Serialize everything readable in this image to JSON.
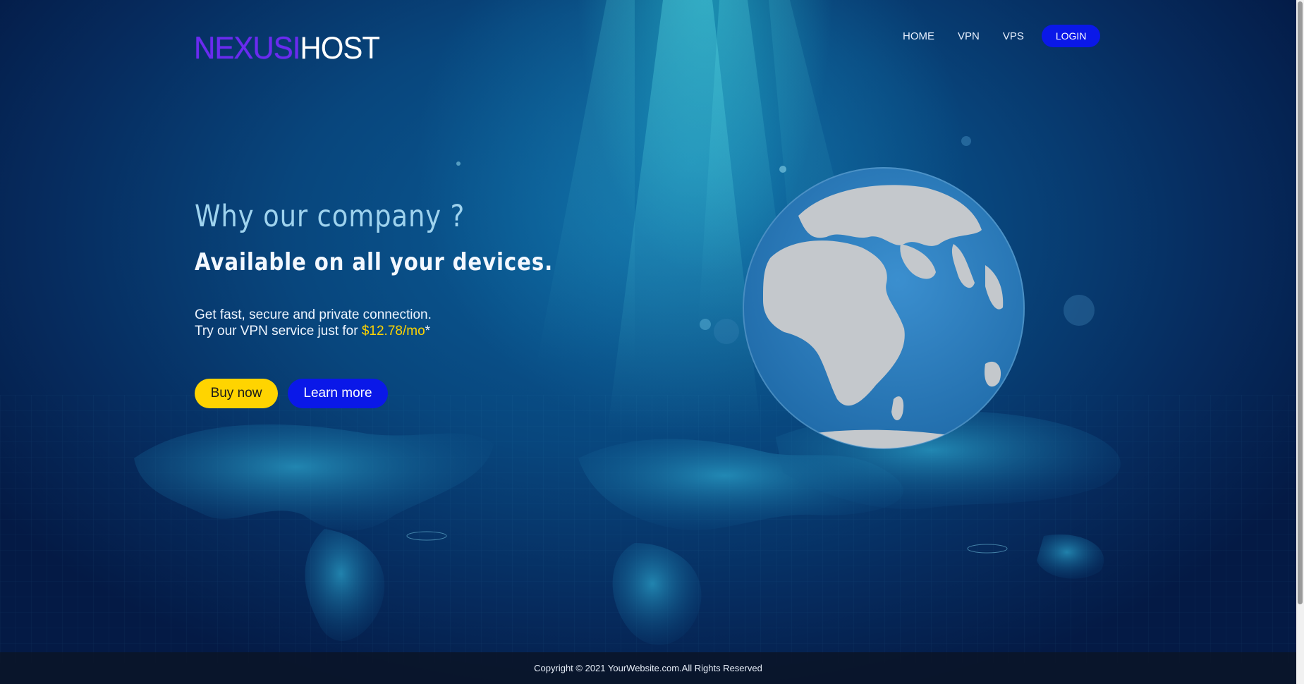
{
  "logo": {
    "part_a": "NEXUSI",
    "part_b": "HOST"
  },
  "nav": {
    "home": "HOME",
    "vpn": "VPN",
    "vps": "VPS",
    "login": "LOGIN"
  },
  "hero": {
    "title": "Why our company ?",
    "subtitle": "Available on all your devices.",
    "line1": "Get fast, secure and private connection.",
    "line2_prefix": "Try our VPN service just for ",
    "price": "$12.78/mo",
    "line2_suffix": "*",
    "buy_label": "Buy now",
    "learn_label": "Learn more"
  },
  "footer": {
    "copyright": "Copyright © 2021 YourWebsite.com.All Rights Reserved"
  },
  "colors": {
    "accent_blue": "#0a18e8",
    "accent_yellow": "#ffd400",
    "logo_purple": "#6a2bf0",
    "title_light_blue": "#9fd3ee",
    "globe_ocean": "#2a78b8",
    "globe_land": "#c4c8cc"
  },
  "icons": [
    "globe-illustration",
    "world-map-background"
  ]
}
